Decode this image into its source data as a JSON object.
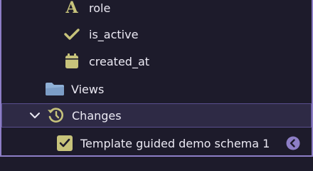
{
  "tree": {
    "items": [
      {
        "label": "role",
        "icon": "text-type-A-icon"
      },
      {
        "label": "is_active",
        "icon": "checkmark-icon"
      },
      {
        "label": "created_at",
        "icon": "calendar-icon"
      }
    ],
    "views": {
      "label": "Views",
      "icon": "folder-icon"
    },
    "changes": {
      "label": "Changes",
      "icon": "history-icon",
      "expanded": true
    },
    "change_entry": {
      "label": "Template guided demo schema 1",
      "checked": true
    }
  },
  "colors": {
    "background": "#1d1b2b",
    "selected_row": "#2e2a45",
    "accent": "#8d7ec6",
    "olive": "#c7c37b",
    "folder": "#8fb0d6"
  }
}
